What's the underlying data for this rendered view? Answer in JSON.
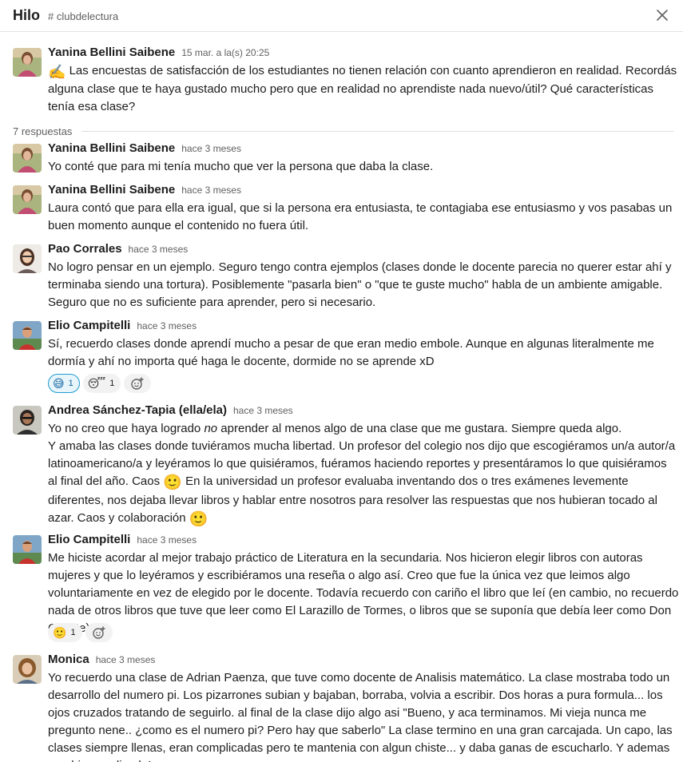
{
  "header": {
    "title": "Hilo",
    "channel": "# clubdelectura"
  },
  "parent": {
    "author": "Yanina Bellini Saibene",
    "timestamp": "15 mar. a la(s) 20:25",
    "emoji": "✍️",
    "text": "Las encuestas de satisfacción de los estudiantes no tienen relación con cuanto aprendieron en realidad.  Recordás alguna clase que te haya gustado mucho pero que en realidad no aprendiste nada nuevo/útil?  Qué características tenía esa clase?"
  },
  "replies_label": "7 respuestas",
  "replies": [
    {
      "author": "Yanina Bellini Saibene",
      "timestamp": "hace 3 meses",
      "text": "Yo conté que para mi tenía mucho que ver la persona que daba la clase."
    },
    {
      "author": "Yanina Bellini Saibene",
      "timestamp": "hace 3 meses",
      "text": "Laura contó que para ella era igual, que si la persona era entusiasta, te contagiaba ese entusiasmo y vos pasabas un buen momento aunque el contenido no fuera útil."
    },
    {
      "author": "Pao Corrales",
      "timestamp": "hace 3 meses",
      "text": "No logro pensar en un ejemplo. Seguro tengo contra ejemplos (clases donde le docente parecia no querer estar ahí y terminaba siendo una tortura). Posiblemente \"pasarla bien\" o \"que te guste mucho\" habla de un ambiente amigable. Seguro que no es suficiente para aprender, pero si necesario."
    },
    {
      "author": "Elio Campitelli",
      "timestamp": "hace 3 meses",
      "text": "Sí, recuerdo clases donde aprendí mucho a pesar de  que eran medio embole. Aunque en algunas literalmente me dormía y ahí no importa qué haga le docente, dormide no se aprende xD",
      "reactions": [
        {
          "emoji": "😅",
          "count": "1",
          "active": true
        },
        {
          "emoji": "😴",
          "count": "1",
          "active": false
        }
      ]
    },
    {
      "author": "Andrea Sánchez-Tapia (ella/ela)",
      "timestamp": "hace 3 meses",
      "text_a": "Yo no creo que haya logrado ",
      "text_em": "no",
      "text_b": " aprender al menos algo de una clase que me gustara. Siempre queda algo.",
      "text_c": "Y amaba las clases donde tuviéramos mucha libertad. Un profesor del colegio nos dijo que escogiéramos un/a autor/a latinoamericano/a y leyéramos lo que quisiéramos, fuéramos haciendo reportes y presentáramos lo que quisiéramos al final del año.  Caos ",
      "emoji_1": "🙂",
      "text_d": "  En la universidad un profesor evaluaba inventando dos o tres exámenes levemente diferentes, nos dejaba llevar libros y hablar entre nosotros para resolver las respuestas que nos hubieran tocado al azar. Caos y colaboración ",
      "emoji_2": "🙂"
    },
    {
      "author": "Elio Campitelli",
      "timestamp": "hace 3 meses",
      "text": "Me hiciste acordar al mejor trabajo práctico de Literatura en la secundaria. Nos hicieron elegir libros con autoras mujeres y que lo leyéramos y escribiéramos una reseña o algo así. Creo que fue la única vez que leimos algo voluntariamente en vez de elegido por le docente. Todavía recuerdo con cariño el libro que leí (en cambio, no recuerdo nada de otros libros que tuve que leer como El Larazillo de Tormes, o libros que se suponía que debía leer como Don Quijote).",
      "reactions": [
        {
          "emoji": "🙂",
          "count": "1",
          "active": false
        }
      ]
    },
    {
      "author": "Monica",
      "timestamp": "hace 3 meses",
      "text": "Yo recuerdo una clase de Adrian Paenza, que tuve como docente de Analisis matemático.  La clase mostraba todo un desarrollo del numero pi. Los pizarrones subian y bajaban, borraba, volvia a escribir. Dos horas a pura formula... los ojos cruzados tratando de seguirlo. al final de la clase dijo algo asi \"Bueno, y aca terminamos. Mi vieja nunca me pregunto nene.. ¿como es el numero pi? Pero hay que saberlo\" La clase termino en una gran carcajada. Un capo, las clases siempre llenas, eran complicadas pero te mantenia con  algun chiste... y daba ganas de escucharlo. Y ademas que bien explicado!"
    }
  ],
  "icons": {
    "close": "close-icon",
    "add_reaction": "add-reaction-icon"
  }
}
